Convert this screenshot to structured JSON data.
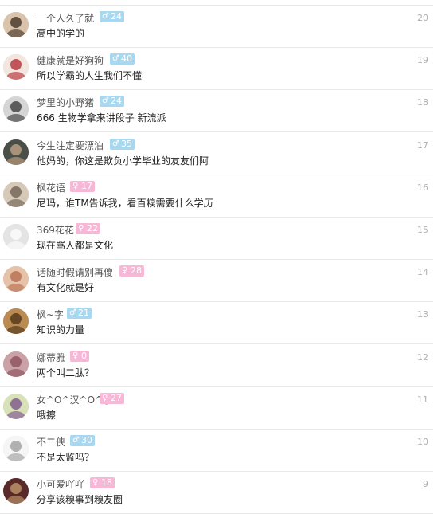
{
  "comments": [
    {
      "username": "一个人久了就",
      "gender_symbol": "♂",
      "gender": "male",
      "level": "24",
      "text": "高中的学的",
      "floor": "20",
      "avatar": {
        "bg": "#d9c3aa",
        "fg": "#3a2a1e"
      }
    },
    {
      "username": "健康就是好狗狗",
      "gender_symbol": "♂",
      "gender": "male",
      "level": "40",
      "text": "所以学霸的人生我们不懂",
      "floor": "19",
      "avatar": {
        "bg": "#f2e6df",
        "fg": "#b3232c"
      }
    },
    {
      "username": "梦里的小野猪",
      "gender_symbol": "♂",
      "gender": "male",
      "level": "24",
      "text": "666 生物学拿来讲段子 新流派",
      "floor": "18",
      "avatar": {
        "bg": "#d5d5d5",
        "fg": "#333333"
      }
    },
    {
      "username": "今生注定要漂泊",
      "gender_symbol": "♂",
      "gender": "male",
      "level": "35",
      "text": "他妈的，你这是欺负小学毕业的友友们阿",
      "floor": "17",
      "avatar": {
        "bg": "#4a4f47",
        "fg": "#c9a88a"
      }
    },
    {
      "username": "枫花语",
      "gender_symbol": "♀",
      "gender": "female",
      "level": "17",
      "text": "尼玛，谁TM告诉我，看百糗需要什么学历",
      "floor": "16",
      "avatar": {
        "bg": "#d6c9b8",
        "fg": "#6a5a4c"
      }
    },
    {
      "username": "369花花",
      "gender_symbol": "♀",
      "gender": "female",
      "level": "22",
      "text": "现在骂人都是文化",
      "floor": "15",
      "avatar": {
        "bg": "#e4e4e4",
        "fg": "#ffffff"
      }
    },
    {
      "username": "话随时假请别再傻",
      "gender_symbol": "♀",
      "gender": "female",
      "level": "28",
      "text": "有文化就是好",
      "floor": "14",
      "avatar": {
        "bg": "#e6c3a8",
        "fg": "#b46a4a"
      }
    },
    {
      "username": "枫~字",
      "gender_symbol": "♂",
      "gender": "male",
      "level": "21",
      "text": "知识的力量",
      "floor": "13",
      "avatar": {
        "bg": "#b98b52",
        "fg": "#4a3016"
      }
    },
    {
      "username": "娜蒂雅",
      "gender_symbol": "♀",
      "gender": "female",
      "level": "0",
      "text": "两个叫二肽？",
      "floor": "12",
      "avatar": {
        "bg": "#c9a1a6",
        "fg": "#8a4b58"
      }
    },
    {
      "username": "女^O^汉^O^子",
      "gender_symbol": "♀",
      "gender": "female",
      "level": "27",
      "text": "哦擦",
      "floor": "11",
      "avatar": {
        "bg": "#d8e2b8",
        "fg": "#7a4a8a"
      }
    },
    {
      "username": "不二侠",
      "gender_symbol": "♂",
      "gender": "male",
      "level": "30",
      "text": "不是太监吗？",
      "floor": "10",
      "avatar": {
        "bg": "#f5f5f5",
        "fg": "#999999"
      }
    },
    {
      "username": "小可爱吖吖",
      "gender_symbol": "♀",
      "gender": "female",
      "level": "18",
      "text": "分享该糗事到糗友圈",
      "floor": "9",
      "avatar": {
        "bg": "#5a2a2a",
        "fg": "#c8a070"
      }
    }
  ]
}
